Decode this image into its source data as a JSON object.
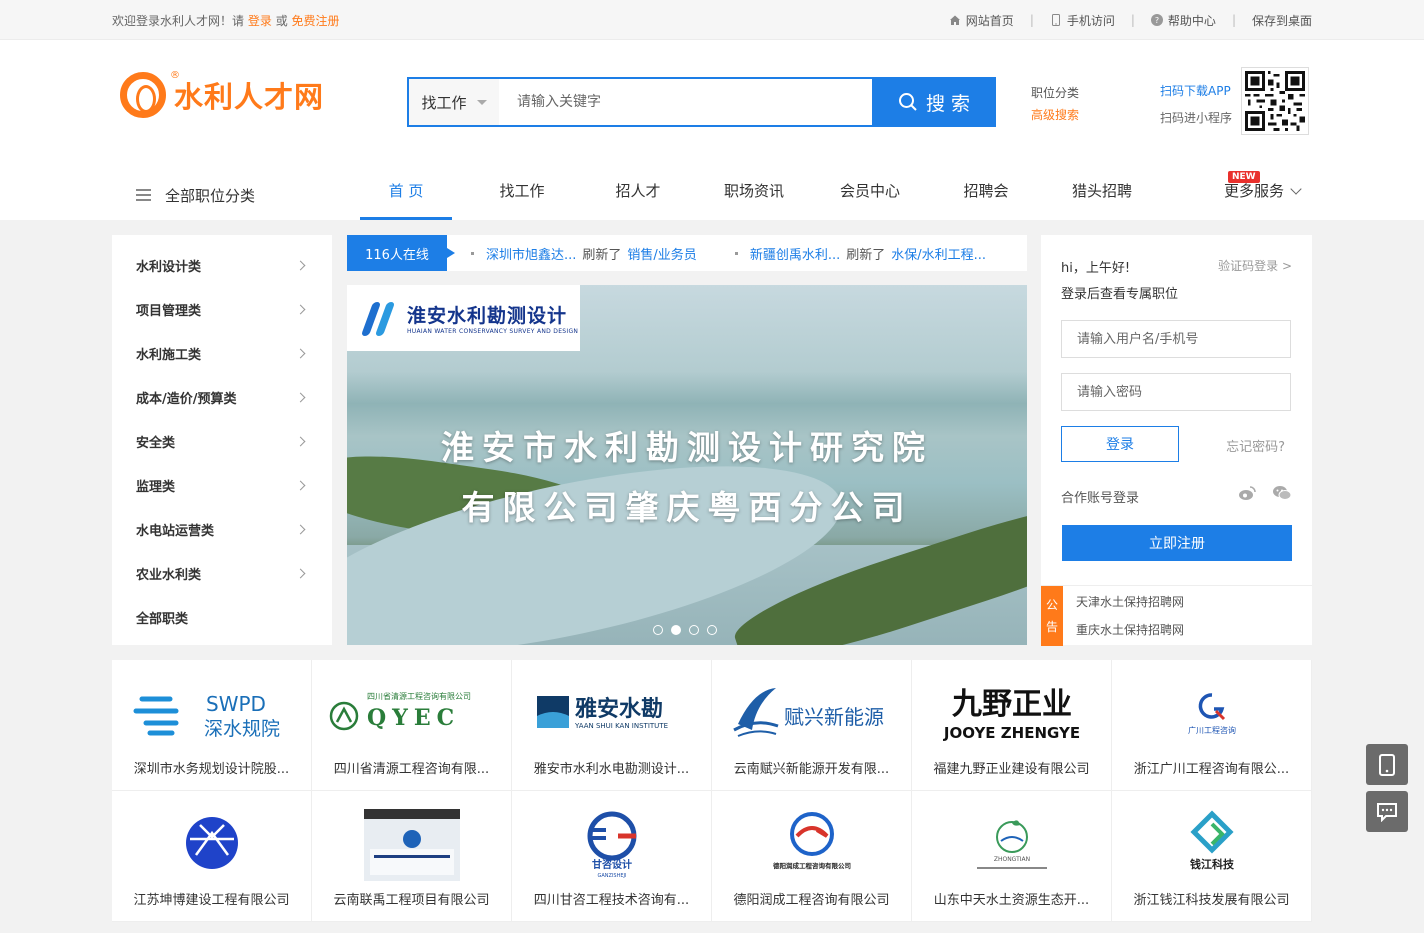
{
  "topbar": {
    "welcome": "欢迎登录水利人才网！请",
    "login": "登录",
    "or": "或",
    "register": "免费注册",
    "links": [
      {
        "icon": "home-icon",
        "label": "网站首页"
      },
      {
        "icon": "phone-icon",
        "label": "手机访问"
      },
      {
        "icon": "help-icon",
        "label": "帮助中心"
      },
      {
        "icon": "",
        "label": "保存到桌面"
      }
    ]
  },
  "logo": {
    "text": "水利人才网",
    "mark": "®"
  },
  "search": {
    "type": "找工作",
    "placeholder": "请输入关键字",
    "button": "搜 索"
  },
  "search_links": {
    "category": "职位分类",
    "advanced": "高级搜索"
  },
  "app": {
    "download": "扫码下载APP",
    "miniprogram": "扫码进小程序"
  },
  "nav": {
    "all_categories": "全部职位分类",
    "items": [
      "首 页",
      "找工作",
      "招人才",
      "职场资讯",
      "会员中心",
      "招聘会",
      "猎头招聘"
    ],
    "more": "更多服务",
    "badge": "NEW"
  },
  "categories": [
    "水利设计类",
    "项目管理类",
    "水利施工类",
    "成本/造价/预算类",
    "安全类",
    "监理类",
    "水电站运营类",
    "农业水利类",
    "全部职类"
  ],
  "ticker": {
    "online": "116人在线",
    "items": [
      {
        "company": "深圳市旭鑫达...",
        "action": "刷新了",
        "job": "销售/业务员"
      },
      {
        "company": "新疆创禹水利...",
        "action": "刷新了",
        "job": "水保/水利工程..."
      }
    ]
  },
  "banner": {
    "logo_cn": "淮安水利勘测设计",
    "logo_en": "HUAIAN WATER CONSERVANCY SURVEY AND DESIGN",
    "line1": "淮安市水利勘测设计研究院",
    "line2": "有限公司肇庆粤西分公司"
  },
  "login": {
    "greeting": "hi，上午好!",
    "subtitle": "登录后查看专属职位",
    "code_login": "验证码登录 >",
    "username_placeholder": "请输入用户名/手机号",
    "password_placeholder": "请输入密码",
    "login_button": "登录",
    "forgot": "忘记密码?",
    "partner_login": "合作账号登录",
    "register_button": "立即注册"
  },
  "notice": {
    "tag": "公告",
    "items": [
      "天津水土保持招聘网",
      "重庆水土保持招聘网"
    ]
  },
  "companies": [
    {
      "name": "深圳市水务规划设计院股...",
      "logo_text": "SWPD",
      "logo_sub": "深水规院"
    },
    {
      "name": "四川省清源工程咨询有限...",
      "logo_text": "QYEC",
      "logo_sub": "四川省清源工程咨询有限公司"
    },
    {
      "name": "雅安市水利水电勘测设计...",
      "logo_text": "雅安水勘",
      "logo_sub": "YAAN SHUI KAN INSTITUTE"
    },
    {
      "name": "云南赋兴新能源开发有限...",
      "logo_text": "赋兴新能源",
      "logo_sub": ""
    },
    {
      "name": "福建九野正业建设有限公司",
      "logo_text": "九野正业",
      "logo_sub": "JOOYE ZHENGYE"
    },
    {
      "name": "浙江广川工程咨询有限公...",
      "logo_text": "广川工程咨询",
      "logo_sub": ""
    },
    {
      "name": "江苏坤博建设工程有限公司",
      "logo_text": "",
      "logo_sub": ""
    },
    {
      "name": "云南联禹工程项目有限公司",
      "logo_text": "",
      "logo_sub": ""
    },
    {
      "name": "四川甘咨工程技术咨询有...",
      "logo_text": "甘咨设计",
      "logo_sub": "GANZISHEJI"
    },
    {
      "name": "德阳润成工程咨询有限公司",
      "logo_text": "德阳润成工程咨询有限公司",
      "logo_sub": ""
    },
    {
      "name": "山东中天水土资源生态开...",
      "logo_text": "ZHONGTIAN",
      "logo_sub": ""
    },
    {
      "name": "浙江钱江科技发展有限公司",
      "logo_text": "钱江科技",
      "logo_sub": ""
    }
  ],
  "colors": {
    "primary": "#1d7ee6",
    "accent": "#ff7a1a"
  }
}
